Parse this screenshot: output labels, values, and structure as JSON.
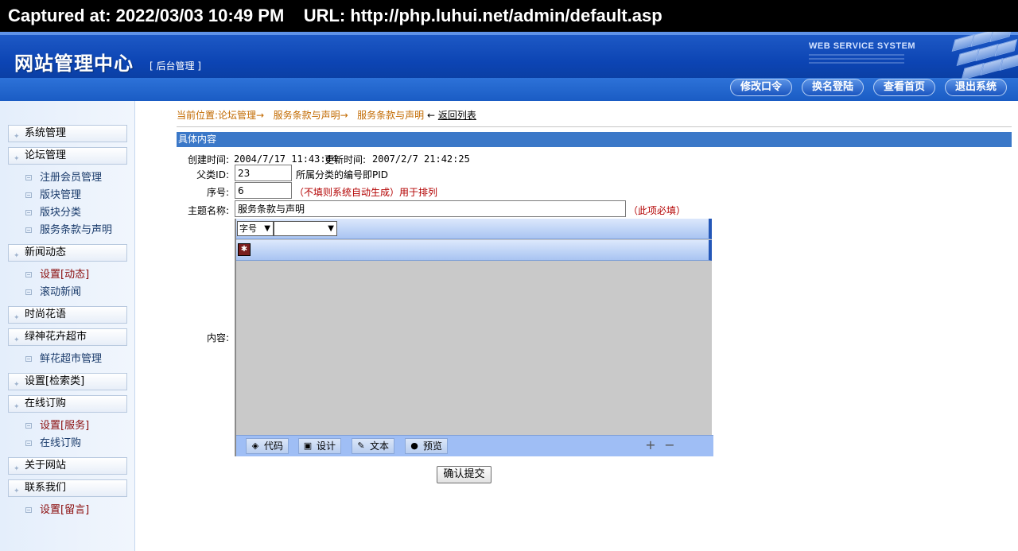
{
  "capture": {
    "text": "Captured at: 2022/03/03 10:49 PM    URL: http://php.luhui.net/admin/default.asp"
  },
  "header": {
    "title": "网站管理中心",
    "subtitle": "[ 后台管理 ]",
    "tagline": "WEB SERVICE SYSTEM",
    "buttons": [
      "修改口令",
      "换名登陆",
      "查看首页",
      "退出系统"
    ]
  },
  "sidebar": {
    "groups": [
      {
        "label": "系统管理",
        "items": []
      },
      {
        "label": "论坛管理",
        "items": [
          {
            "label": "注册会员管理",
            "highlight": false
          },
          {
            "label": "版块管理",
            "highlight": false
          },
          {
            "label": "版块分类",
            "highlight": false
          },
          {
            "label": "服务条款与声明",
            "highlight": false
          }
        ]
      },
      {
        "label": "新闻动态",
        "items": [
          {
            "label": "设置[动态]",
            "highlight": true
          },
          {
            "label": "滚动新闻",
            "highlight": false
          }
        ]
      },
      {
        "label": "时尚花语",
        "items": []
      },
      {
        "label": "绿神花卉超市",
        "items": [
          {
            "label": "鲜花超市管理",
            "highlight": false
          }
        ]
      },
      {
        "label": "设置[检索类]",
        "items": []
      },
      {
        "label": "在线订购",
        "items": [
          {
            "label": "设置[服务]",
            "highlight": true
          },
          {
            "label": "在线订购",
            "highlight": false
          }
        ]
      },
      {
        "label": "关于网站",
        "items": []
      },
      {
        "label": "联系我们",
        "items": [
          {
            "label": "设置[留言]",
            "highlight": true
          }
        ]
      }
    ]
  },
  "breadcrumb": {
    "prefix": "当前位置:论坛管理",
    "arrow": "→",
    "step1": "服务条款与声明",
    "step2": "服务条款与声明",
    "back_arrow": "←",
    "back": "返回列表"
  },
  "panel": {
    "title": "具体内容"
  },
  "form": {
    "created_label": "创建时间:",
    "created_value": "2004/7/17 11:43:44",
    "updated_label": "更新时间:",
    "updated_value": "2007/2/7 21:42:25",
    "parent_id_label": "父类ID:",
    "parent_id_value": "23",
    "parent_id_note": "所属分类的编号即PID",
    "order_label": "序号:",
    "order_value": "6",
    "order_note": "（不填则系统自动生成）用于排列",
    "subject_label": "主题名称:",
    "subject_value": "服务条款与声明",
    "subject_note": "（此项必填）",
    "content_label": "内容:",
    "submit": "确认提交"
  },
  "editor": {
    "font_size_select": "字号",
    "font_select": "",
    "modes": [
      "代码",
      "设计",
      "文本",
      "预览"
    ],
    "zoom_in": "+",
    "zoom_out": "−"
  }
}
